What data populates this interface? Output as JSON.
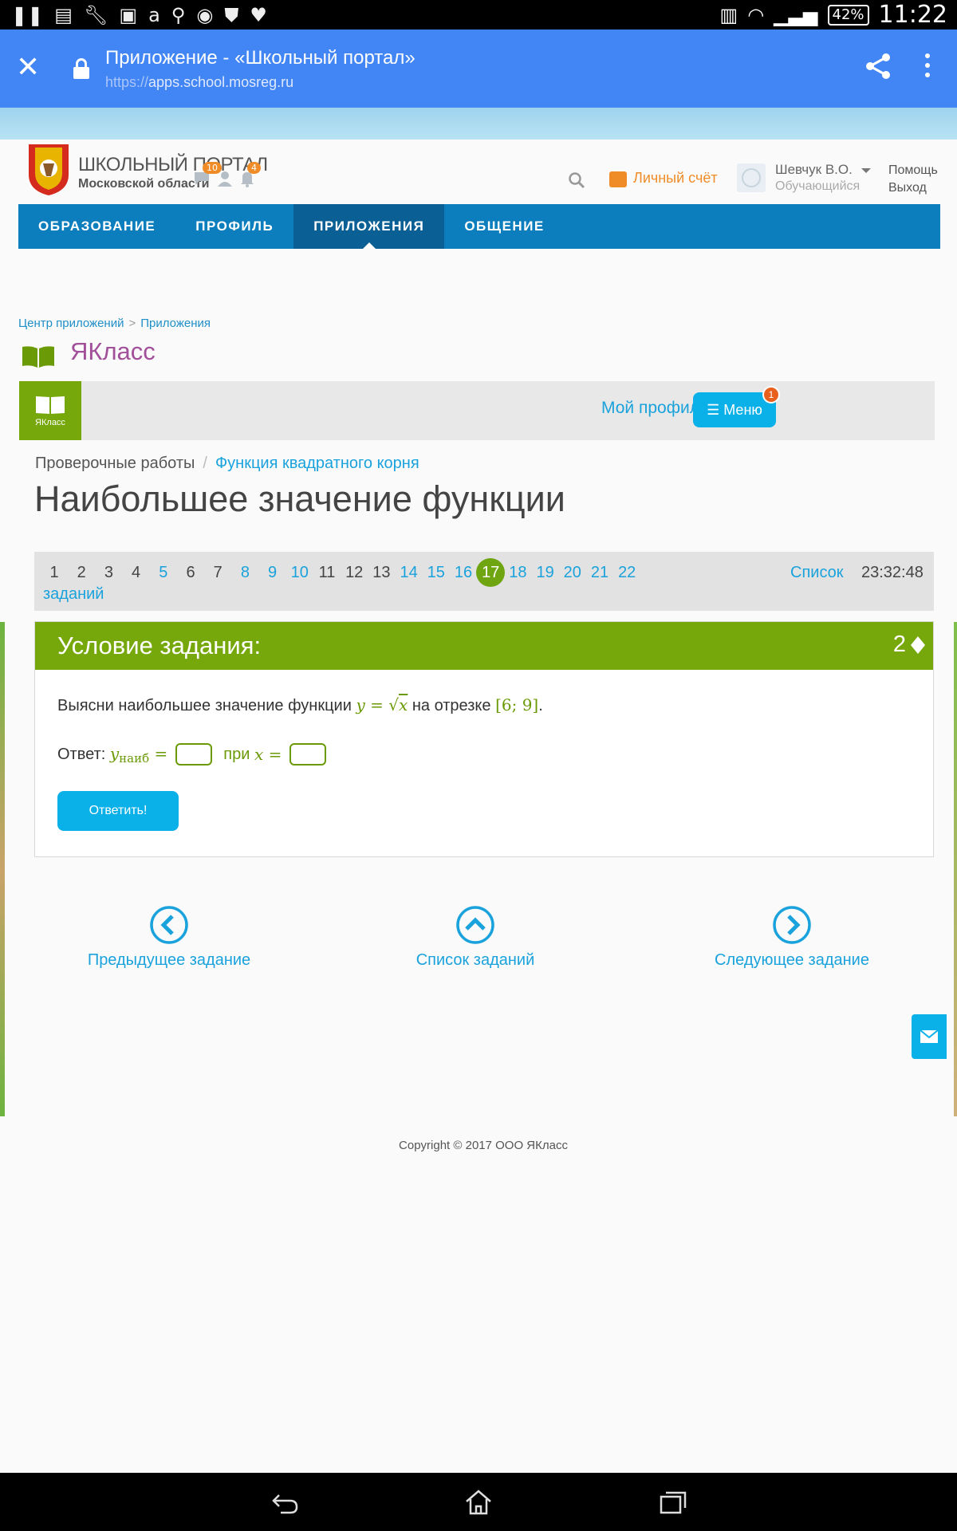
{
  "status_bar": {
    "battery": "42%",
    "time": "11:22",
    "left_icons": [
      "pause-icon",
      "save-icon",
      "wrench-icon",
      "image-icon",
      "a-icon",
      "search-icon",
      "location-icon",
      "shield-icon",
      "heart-icon"
    ]
  },
  "browser": {
    "title": "Приложение - «Школьный портал»",
    "url_proto": "https://",
    "url_host": "apps.school.mosreg.ru"
  },
  "portal": {
    "title_line1": "ШКОЛЬНЫЙ ПОРТАЛ",
    "title_line2": "Московской области",
    "messages_count": "10",
    "notifications_count": "4",
    "account_label": "Личный счёт",
    "user_name": "Шевчук В.О.",
    "user_role": "Обучающийся",
    "help_label": "Помощь",
    "exit_label": "Выход",
    "nav": [
      "ОБРАЗОВАНИЕ",
      "ПРОФИЛЬ",
      "ПРИЛОЖЕНИЯ",
      "ОБЩЕНИЕ"
    ],
    "breadcrumbs": [
      "Центр приложений",
      "Приложения"
    ],
    "app_name": "ЯКласс"
  },
  "yaklass": {
    "logo_text": "ЯКласс",
    "my_profile": "Мой профиль",
    "menu_label": "Меню",
    "menu_badge": "1",
    "breadcrumb_section": "Проверочные работы",
    "breadcrumb_topic": "Функция квадратного корня",
    "page_title": "Наибольшее значение функции",
    "pager": {
      "pages": [
        "1",
        "2",
        "3",
        "4",
        "5",
        "6",
        "7",
        "8",
        "9",
        "10",
        "11",
        "12",
        "13",
        "14",
        "15",
        "16",
        "17",
        "18",
        "19",
        "20",
        "21",
        "22"
      ],
      "active": "17",
      "linked": [
        "5",
        "8",
        "9",
        "10",
        "14",
        "15",
        "16",
        "18",
        "19",
        "20",
        "21",
        "22"
      ],
      "list_label_1": "Список",
      "list_label_2": "заданий",
      "timer": "23:32:48"
    },
    "task": {
      "header": "Условие задания:",
      "points": "2",
      "question_text_1": "Выясни наибольшее значение функции",
      "question_text_2": "на отрезке",
      "func_lhs": "y",
      "func_eq": "=",
      "func_arg": "x",
      "interval": "[6; 9]",
      "answer_label": "Ответ:",
      "answer_var": "y",
      "answer_sub": "наиб",
      "answer_eq": "=",
      "at_label": "при",
      "at_var": "x",
      "at_eq": "=",
      "submit_label": "Ответить!"
    },
    "nav_prev": "Предыдущее задание",
    "nav_list": "Список заданий",
    "nav_next": "Следующее задание",
    "copyright": "Copyright © 2017 ООО ЯКласс"
  }
}
